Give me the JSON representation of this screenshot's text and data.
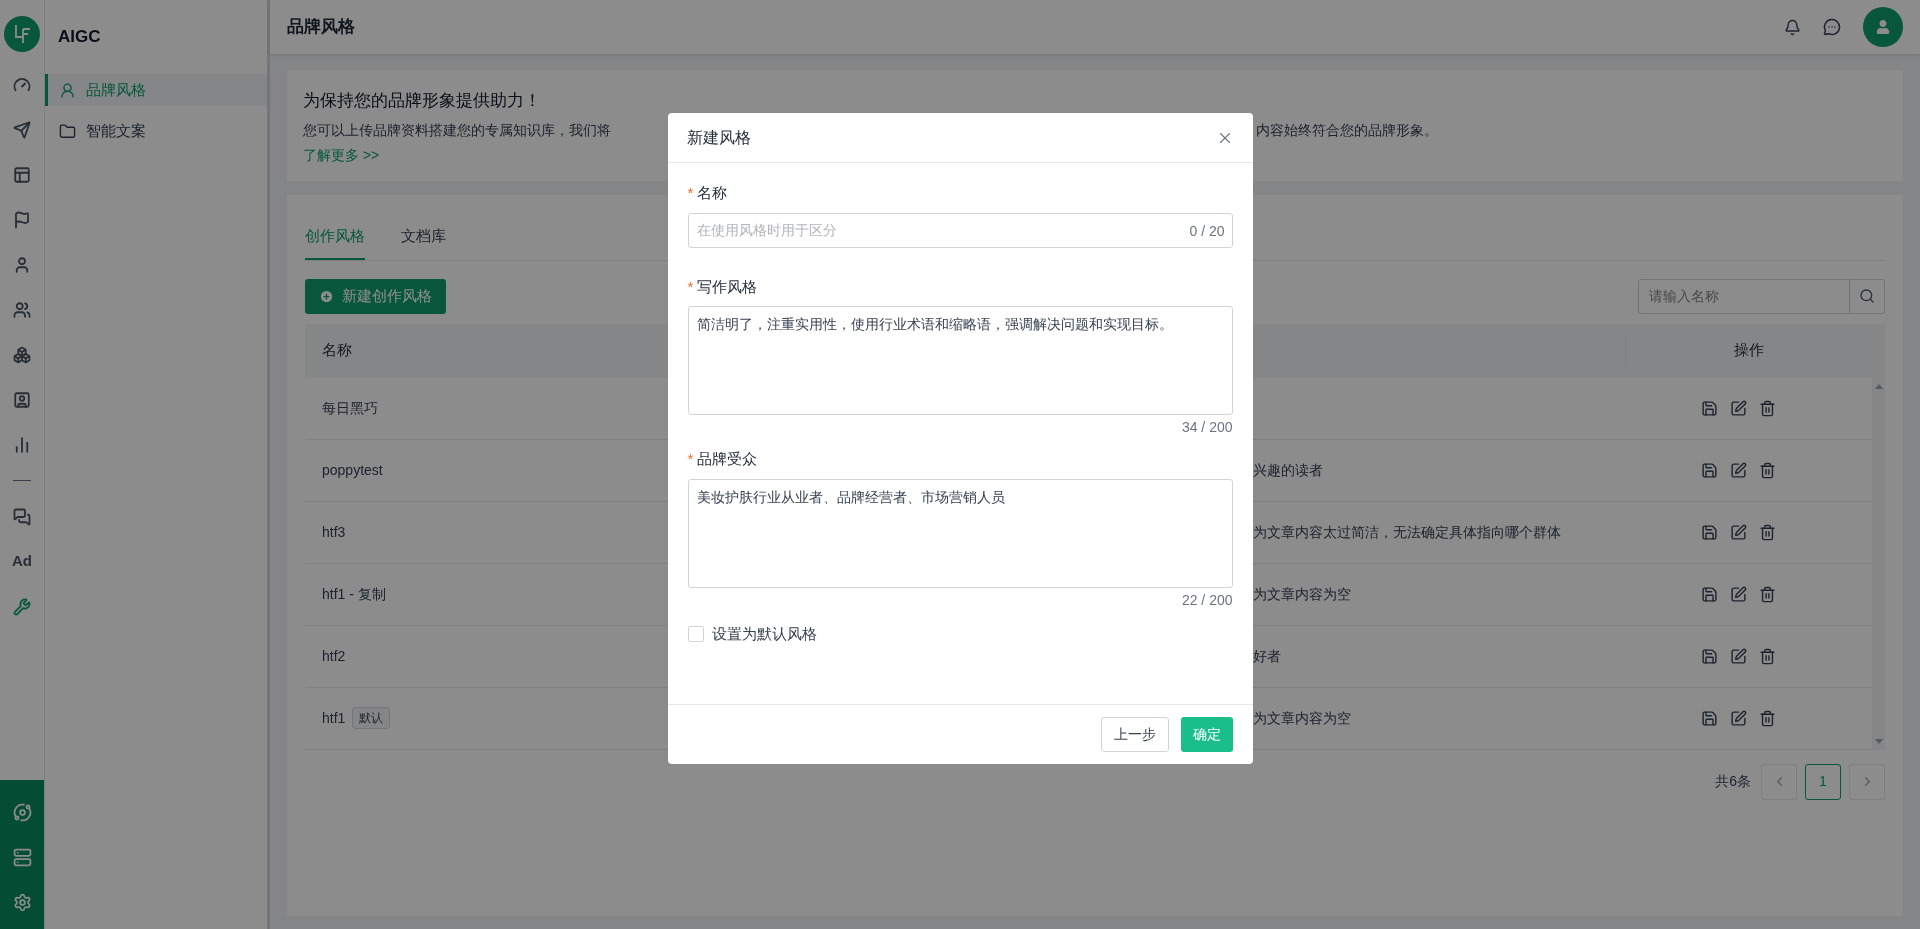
{
  "rail": {
    "items": [
      {
        "kind": "icon",
        "selected": false
      },
      {
        "kind": "icon",
        "selected": false
      },
      {
        "kind": "icon",
        "selected": false
      },
      {
        "kind": "icon",
        "selected": false
      },
      {
        "kind": "icon",
        "selected": false
      },
      {
        "kind": "icon",
        "selected": false
      },
      {
        "kind": "icon",
        "selected": false
      },
      {
        "kind": "icon",
        "selected": false
      },
      {
        "kind": "icon",
        "selected": false
      },
      {
        "kind": "divider"
      },
      {
        "kind": "icon",
        "selected": false
      },
      {
        "kind": "text",
        "label": "Ad",
        "selected": false
      },
      {
        "kind": "icon",
        "selected": true
      }
    ]
  },
  "sidebar": {
    "title": "AIGC",
    "items": [
      {
        "label": "品牌风格",
        "selected": true
      },
      {
        "label": "智能文案",
        "selected": false
      }
    ]
  },
  "header": {
    "title": "品牌风格"
  },
  "banner": {
    "title": "为保持您的品牌形象提供助力！",
    "text_parts": [
      "您可以上传品牌资料搭建您的专属知识库，我们将",
      "内容始终符合您的品牌形象。"
    ],
    "link": "了解更多 >>"
  },
  "tabs": [
    {
      "label": "创作风格",
      "selected": true
    },
    {
      "label": "文档库",
      "selected": false
    }
  ],
  "new_button": "新建创作风格",
  "search": {
    "placeholder": "请输入名称"
  },
  "table": {
    "columns": [
      "名称",
      "操作"
    ],
    "rows": [
      {
        "name": "每日黑巧"
      },
      {
        "name": "poppytest",
        "column_2": "兴趣的读者"
      },
      {
        "name": "htf3",
        "column_2": "为文章内容太过简洁，无法确定具体指向哪个群体"
      },
      {
        "name": "htf1 - 复制",
        "column_2": "为文章内容为空"
      },
      {
        "name": "htf2",
        "column_2": "好者"
      },
      {
        "name": "htf1",
        "tag": "默认",
        "column_2": "为文章内容为空"
      }
    ]
  },
  "pagination": {
    "total": "共6条",
    "pages": [
      {
        "label": "1",
        "selected": true
      }
    ]
  },
  "dialog": {
    "title": "新建风格",
    "fields": [
      {
        "kind": "input",
        "required_mark": "*",
        "label": "名称",
        "placeholder": "在使用风格时用于区分",
        "counter": "0 / 20"
      },
      {
        "kind": "textarea",
        "required_mark": "*",
        "label": "写作风格",
        "value": "简洁明了，注重实用性，使用行业术语和缩略语，强调解决问题和实现目标。",
        "counter": "34 / 200"
      },
      {
        "kind": "textarea",
        "required_mark": "*",
        "label": "品牌受众",
        "value": "美妆护肤行业从业者、品牌经营者、市场营销人员",
        "counter": "22 / 200"
      }
    ],
    "checkbox": {
      "label": "设置为默认风格",
      "checked": false
    },
    "buttons": [
      {
        "kind": "secondary",
        "label": "上一步"
      },
      {
        "kind": "primary",
        "label": "确定"
      }
    ]
  }
}
